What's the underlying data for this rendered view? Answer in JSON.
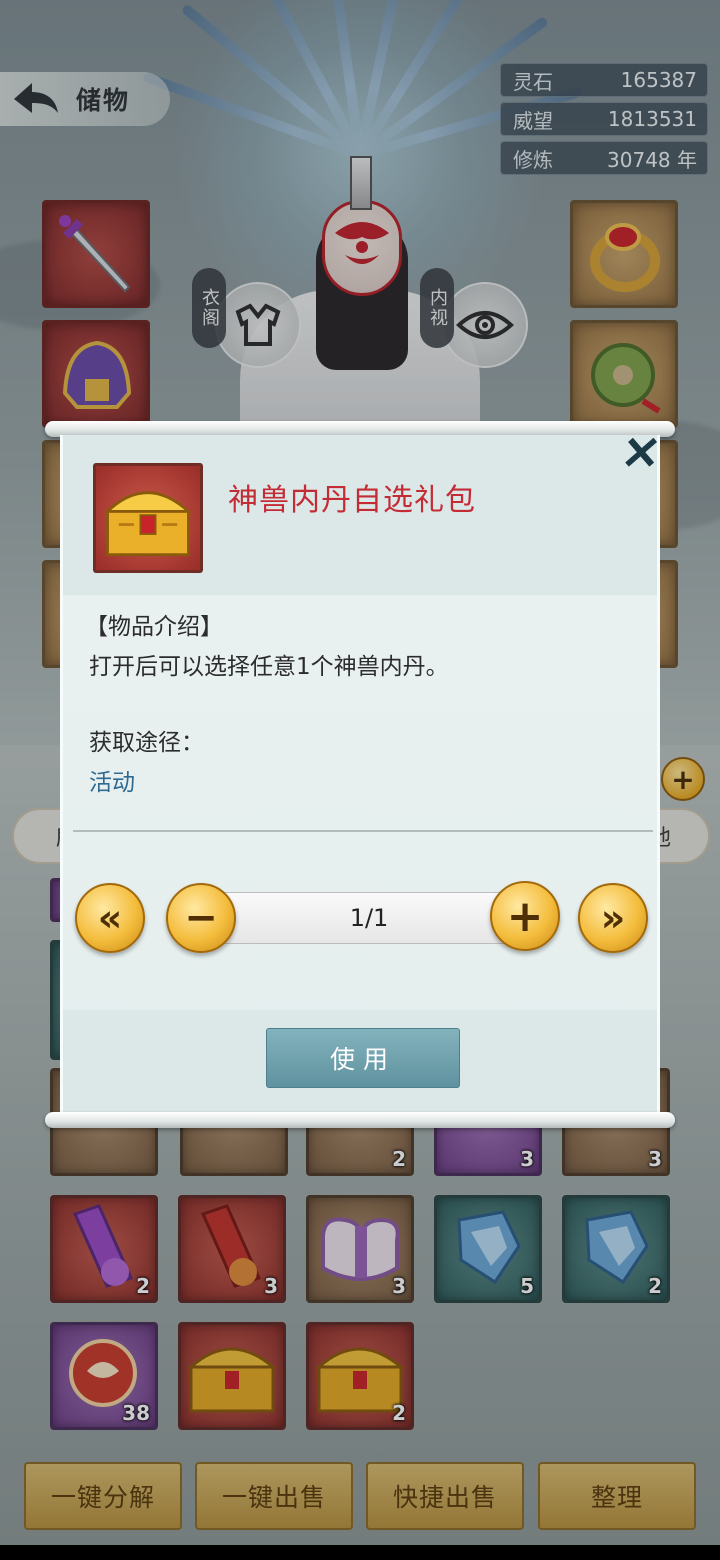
{
  "header": {
    "back_label": "储物"
  },
  "stats": [
    {
      "label": "灵石",
      "value": "165387"
    },
    {
      "label": "威望",
      "value": "1813531"
    },
    {
      "label": "修炼",
      "value": "30748 年"
    }
  ],
  "character": {
    "left_tag": "衣阁",
    "right_tag": "内视"
  },
  "filters": {
    "left_label": "所",
    "right_label": "他"
  },
  "bag_items": [
    {
      "count": "2"
    },
    {
      "count": "3"
    },
    {
      "count": "3"
    },
    {
      "count": "2"
    },
    {
      "count": "3"
    },
    {
      "count": "3"
    },
    {
      "count": "5"
    },
    {
      "count": "2"
    },
    {
      "count": "38"
    },
    {
      "count": ""
    },
    {
      "count": "2"
    }
  ],
  "bottom_buttons": {
    "decompose": "一键分解",
    "sell_all": "一键出售",
    "quick_sell": "快捷出售",
    "sort": "整理"
  },
  "modal": {
    "title": "神兽内丹自选礼包",
    "close_icon": "✕",
    "desc_label": "【物品介绍】",
    "desc_text": "打开后可以选择任意1个神兽内丹。",
    "source_label": "获取途径：",
    "source_link": "活动",
    "quantity": "1/1",
    "min_label": "«",
    "minus_label": "−",
    "plus_label": "+",
    "max_label": "»",
    "use_label": "使用"
  },
  "colors": {
    "title_red": "#c42c35",
    "link_blue": "#2f6a93",
    "use_button": "#6fa3ae",
    "gold": "#f4bd3d"
  }
}
